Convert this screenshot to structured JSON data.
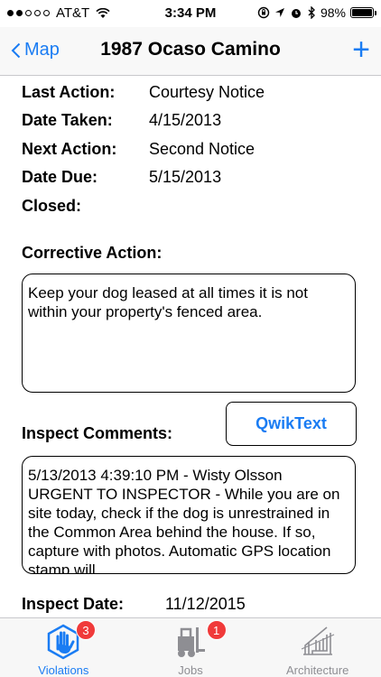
{
  "status_bar": {
    "carrier": "AT&T",
    "time": "3:34 PM",
    "battery": "98%",
    "battery_level": 0.98
  },
  "nav": {
    "back_label": "Map",
    "title": "1987 Ocaso Camino",
    "add_label": "+"
  },
  "fields": [
    {
      "label": "Last Action:",
      "value": "Courtesy Notice"
    },
    {
      "label": "Date Taken:",
      "value": "4/15/2013"
    },
    {
      "label": "Next Action:",
      "value": "Second Notice"
    },
    {
      "label": "Date Due:",
      "value": "5/15/2013"
    },
    {
      "label": "Closed:",
      "value": ""
    }
  ],
  "corrective_action": {
    "label": "Corrective Action:",
    "text": "Keep your dog leased at all times it is not within your property's fenced area."
  },
  "inspect_comments": {
    "label": "Inspect Comments:",
    "button_label": "QwikText",
    "text": "5/13/2013 4:39:10 PM - Wisty Olsson URGENT TO INSPECTOR - While you are on site today, check if the dog is unrestrained in the Common Area behind the house. If so, capture with photos. Automatic GPS location stamp will"
  },
  "inspect_date": {
    "label": "Inspect Date:",
    "value": "11/12/2015"
  },
  "tabs": [
    {
      "label": "Violations",
      "badge": "3",
      "icon": "hand-icon",
      "active": true
    },
    {
      "label": "Jobs",
      "badge": "1",
      "icon": "forklift-icon",
      "active": false
    },
    {
      "label": "Architecture",
      "badge": "",
      "icon": "architecture-icon",
      "active": false
    }
  ],
  "colors": {
    "accent": "#1a7cf3",
    "badge": "#f03a3a",
    "inactive_tab": "#8e8e93"
  }
}
